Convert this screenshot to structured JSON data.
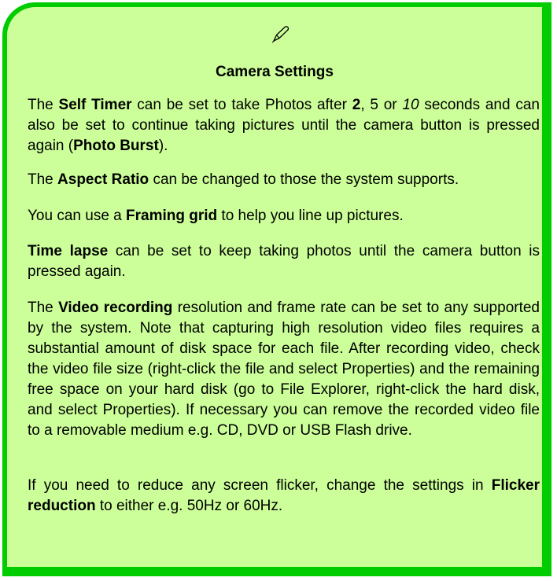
{
  "note": {
    "accent_fill": "#ccff99",
    "accent_border": "#00cc00",
    "icon": "pen-icon",
    "title": "Camera Settings",
    "p1": {
      "a": "The ",
      "b_self_timer": "Self Timer",
      "c": " can be set to take Photos after ",
      "d_two": "2",
      "e": ", 5 or ",
      "f_ten": "10",
      "g": " seconds and can also be set to continue taking pictures until the camera button is pressed again (",
      "h_photo_burst": "Photo Burst",
      "i": ")."
    },
    "p2": {
      "a": "The ",
      "b_aspect_ratio": "Aspect Ratio",
      "c": " can be changed to those the system supports."
    },
    "p3": {
      "a": "You can use a ",
      "b_framing_grid": "Framing grid",
      "c": " to help you line up pictures."
    },
    "p4": {
      "b_time_lapse": "Time lapse",
      "c": " can be set to keep taking photos until the camera button is pressed again."
    },
    "p5": {
      "a": "The ",
      "b_video_recording": "Video recording",
      "c": " resolution and frame rate can be set to any supported by the system. Note that capturing high resolution video files requires a substantial amount of disk space for each file. After recording video, check the video file size (right-click the file and select Properties) and the remaining free space on your hard disk (go to File Explorer, right-click the hard disk, and select Properties). If necessary you can remove the recorded video file to a removable medium e.g. CD, DVD or USB Flash drive."
    },
    "p6": {
      "a": "If you need to reduce any screen flicker, change the settings in ",
      "b_flicker_reduction": "Flicker reduction",
      "c": " to either e.g. 50Hz or 60Hz."
    }
  }
}
